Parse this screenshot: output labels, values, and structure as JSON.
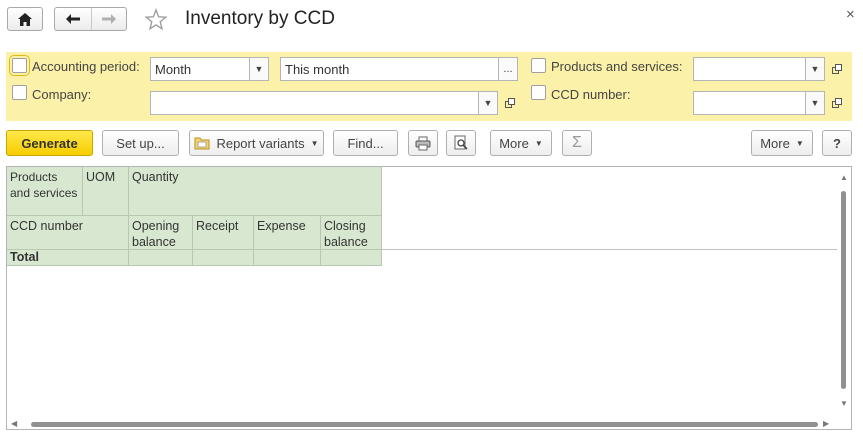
{
  "window": {
    "title": "Inventory by CCD",
    "close_glyph": "×"
  },
  "nav": {
    "home_icon": "home-icon",
    "back_icon": "arrow-left-icon",
    "forward_icon": "arrow-right-icon",
    "favorite_icon": "star-icon"
  },
  "filters": {
    "accounting_period": {
      "label": "Accounting period:",
      "checked": false,
      "period_type": "Month",
      "period_value": "This month",
      "ellipsis": "..."
    },
    "company": {
      "label": "Company:",
      "checked": false,
      "value": ""
    },
    "products_services": {
      "label": "Products and services:",
      "checked": false,
      "value": ""
    },
    "ccd_number": {
      "label": "CCD number:",
      "checked": false,
      "value": ""
    }
  },
  "toolbar": {
    "generate": "Generate",
    "set_up": "Set up...",
    "report_variants": "Report variants",
    "find": "Find...",
    "more": "More",
    "more_right": "More",
    "help": "?",
    "sum_glyph": "Σ"
  },
  "report": {
    "headers": {
      "products": "Products and services",
      "uom": "UOM",
      "quantity": "Quantity",
      "ccd_number": "CCD number",
      "opening_balance": "Opening balance",
      "receipt": "Receipt",
      "expense": "Expense",
      "closing_balance": "Closing balance"
    },
    "total_label": "Total"
  },
  "colors": {
    "filter_bg": "#fcf1a8",
    "header_bg": "#d8e8d0",
    "primary_button": "#f6cd00"
  }
}
